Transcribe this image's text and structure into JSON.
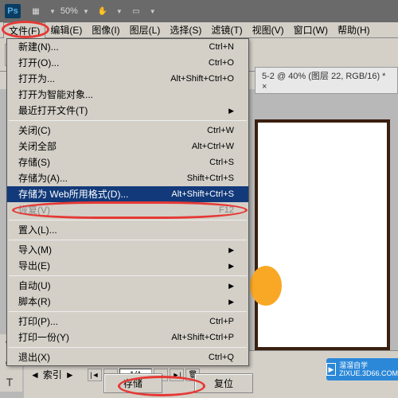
{
  "titlebar": {
    "logo": "Ps",
    "zoom": "50%"
  },
  "menubar": {
    "items": [
      {
        "label": "文件(F)"
      },
      {
        "label": "编辑(E)"
      },
      {
        "label": "图像(I)"
      },
      {
        "label": "图层(L)"
      },
      {
        "label": "选择(S)"
      },
      {
        "label": "滤镜(T)"
      },
      {
        "label": "视图(V)"
      },
      {
        "label": "窗口(W)"
      },
      {
        "label": "帮助(H)"
      }
    ]
  },
  "doc_tab": "5-2 @ 40% (图层 22, RGB/16) * ×",
  "file_menu": {
    "groups": [
      [
        {
          "label": "新建(N)...",
          "shortcut": "Ctrl+N"
        },
        {
          "label": "打开(O)...",
          "shortcut": "Ctrl+O"
        },
        {
          "label": "打开为...",
          "shortcut": "Alt+Shift+Ctrl+O"
        },
        {
          "label": "打开为智能对象..."
        },
        {
          "label": "最近打开文件(T)",
          "submenu": true
        }
      ],
      [
        {
          "label": "关闭(C)",
          "shortcut": "Ctrl+W"
        },
        {
          "label": "关闭全部",
          "shortcut": "Alt+Ctrl+W"
        },
        {
          "label": "存储(S)",
          "shortcut": "Ctrl+S"
        },
        {
          "label": "存储为(A)...",
          "shortcut": "Shift+Ctrl+S"
        },
        {
          "label": "存储为 Web所用格式(D)...",
          "shortcut": "Alt+Shift+Ctrl+S",
          "highlighted": true
        },
        {
          "label": "恢复(V)",
          "shortcut": "F12",
          "disabled": true
        }
      ],
      [
        {
          "label": "置入(L)..."
        }
      ],
      [
        {
          "label": "导入(M)",
          "submenu": true
        },
        {
          "label": "导出(E)",
          "submenu": true
        }
      ],
      [
        {
          "label": "自动(U)",
          "submenu": true
        },
        {
          "label": "脚本(R)",
          "submenu": true
        }
      ],
      [
        {
          "label": "打印(P)...",
          "shortcut": "Ctrl+P"
        },
        {
          "label": "打印一份(Y)",
          "shortcut": "Alt+Shift+Ctrl+P"
        }
      ],
      [
        {
          "label": "退出(X)",
          "shortcut": "Ctrl+Q"
        }
      ]
    ]
  },
  "bottom": {
    "index_label": "索引",
    "page": "1/1",
    "save_btn": "存储",
    "reset_btn": "复位"
  },
  "watermark": {
    "brand": "溜溜自学",
    "url": "ZIXUE.3D66.COM"
  }
}
